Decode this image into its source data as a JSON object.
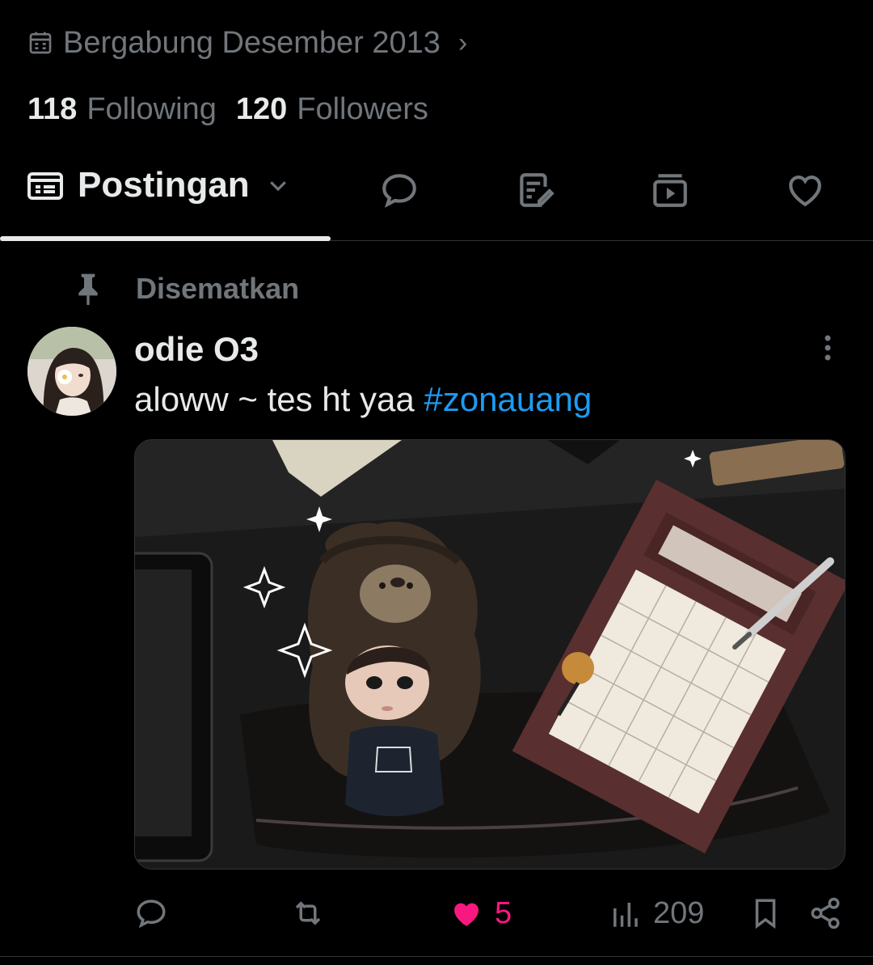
{
  "profile": {
    "joined": "Bergabung Desember 2013",
    "following_count": "118",
    "following_label": "Following",
    "followers_count": "120",
    "followers_label": "Followers"
  },
  "tabs": {
    "active_label": "Postingan",
    "icons": [
      "replies-icon",
      "articles-icon",
      "media-icon",
      "likes-icon"
    ]
  },
  "post": {
    "pinned_label": "Disematkan",
    "author": "odie O3",
    "text": "aloww ~ tes ht yaa ",
    "hashtag": "#zonauang",
    "likes": "5",
    "views": "209"
  },
  "colors": {
    "background": "#000000",
    "primary_text": "#e7e9ea",
    "secondary_text": "#71767b",
    "link": "#1d9bf0",
    "like": "#f91880"
  }
}
